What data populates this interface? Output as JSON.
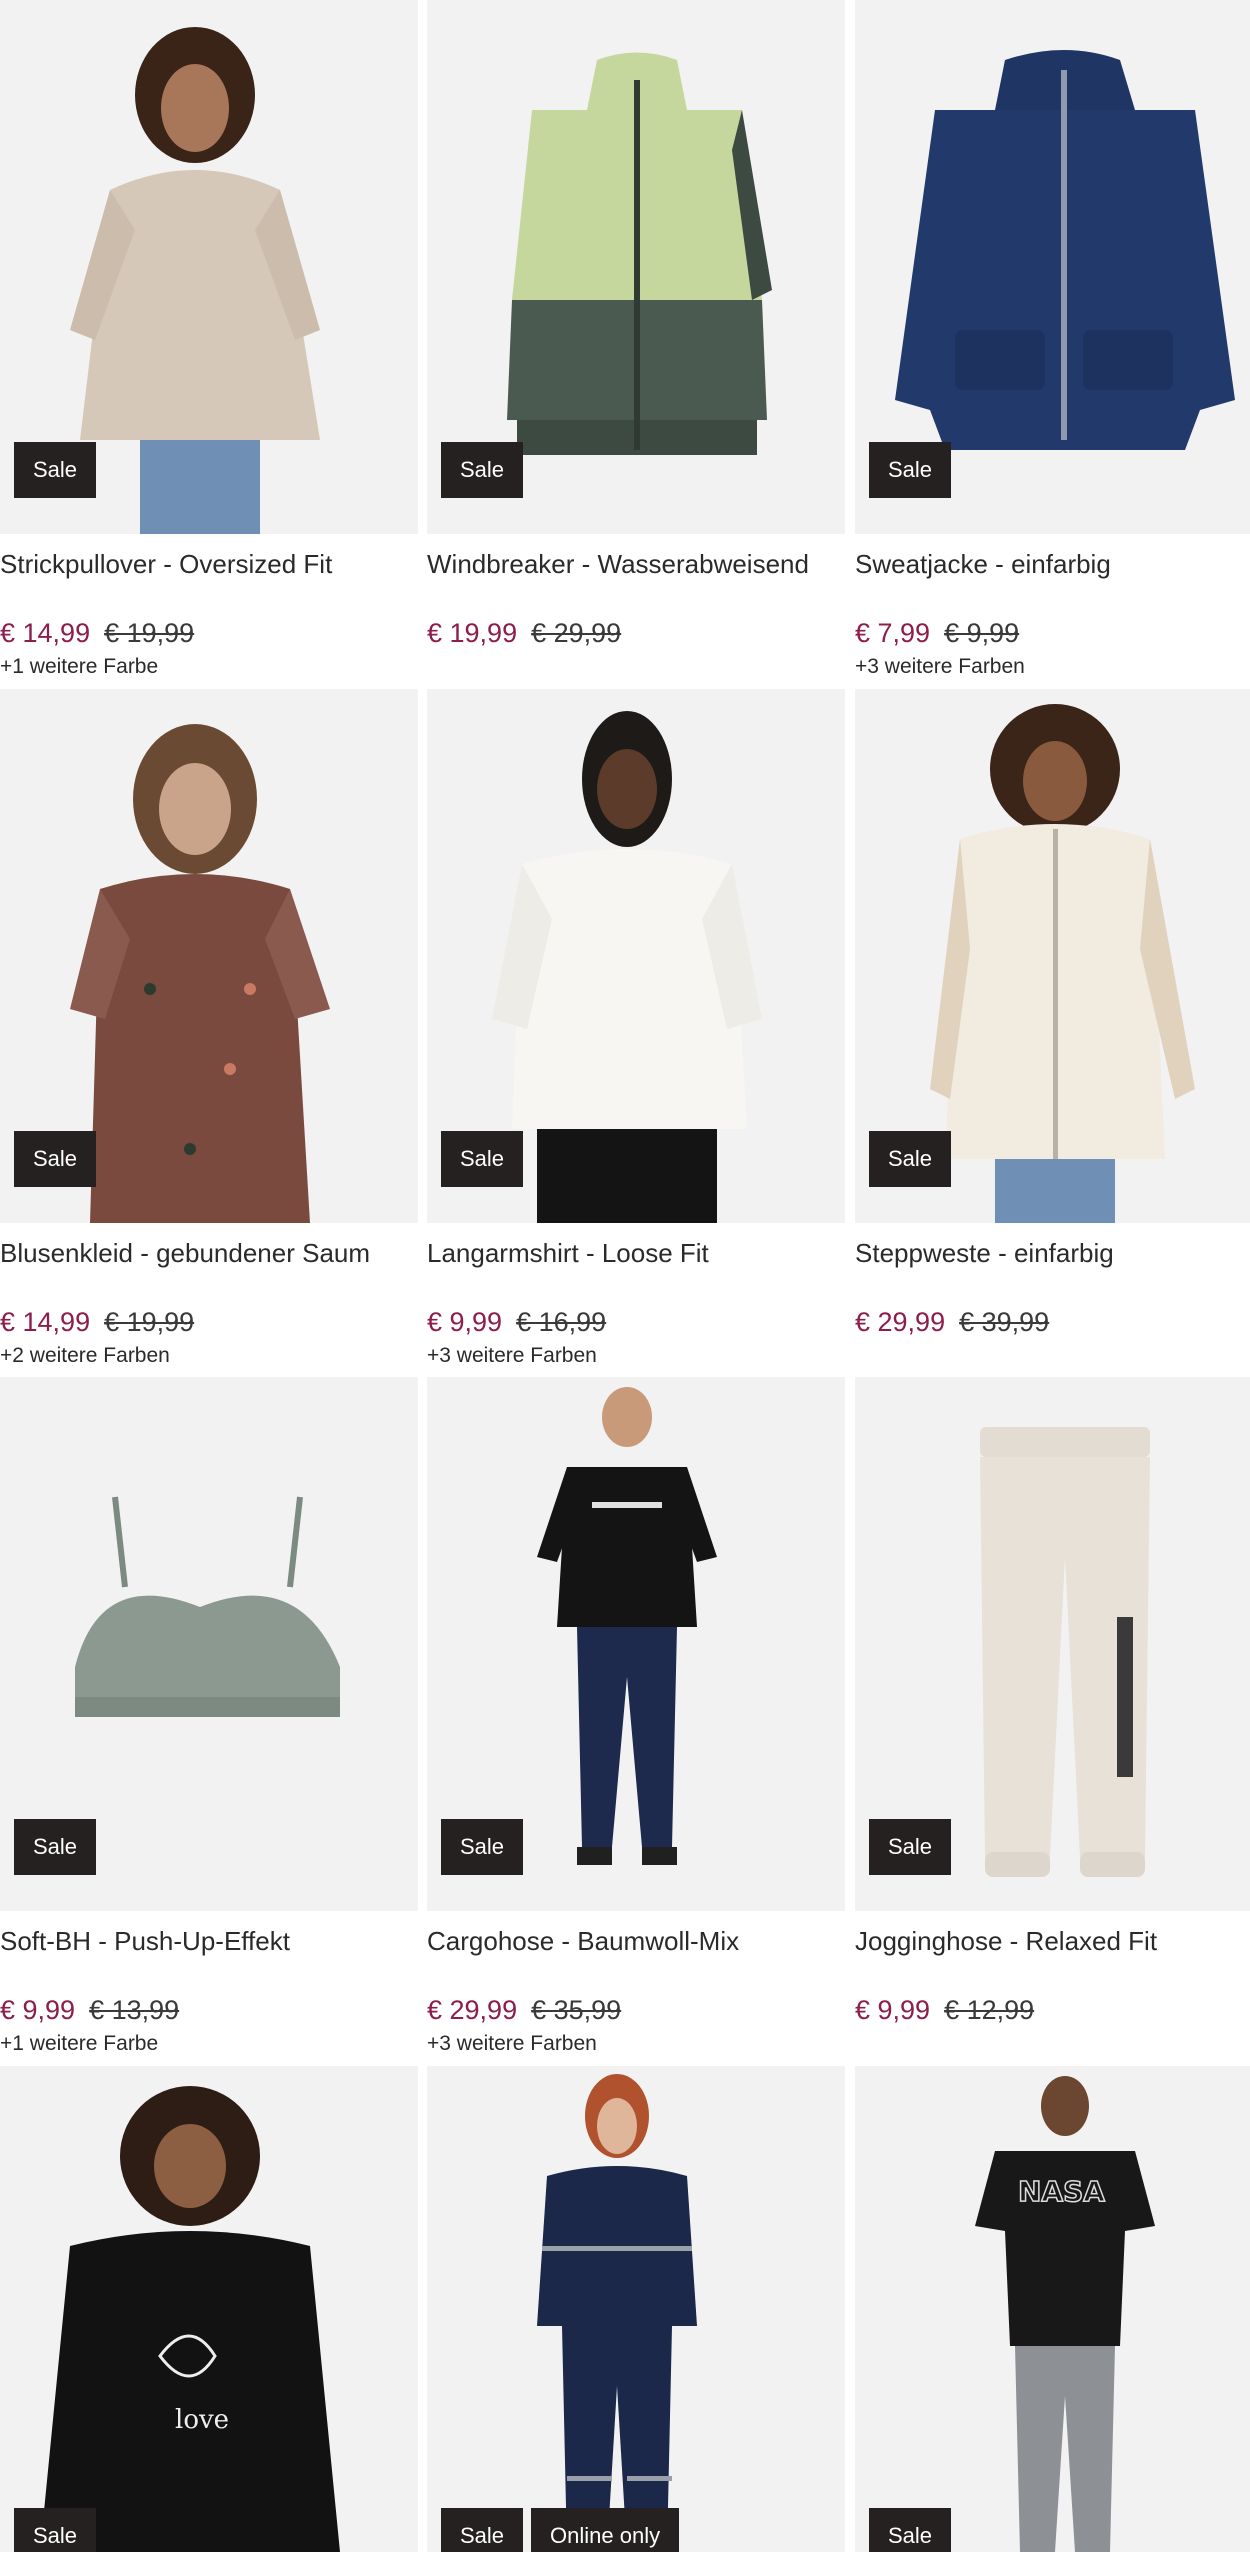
{
  "products": [
    {
      "title": "Strickpullover - Oversized Fit",
      "price": "€ 14,99",
      "old_price": "€ 19,99",
      "more": "+1 weitere Farbe",
      "badges": [
        "Sale"
      ]
    },
    {
      "title": "Windbreaker - Wasserabweisend",
      "price": "€ 19,99",
      "old_price": "€ 29,99",
      "more": "",
      "badges": [
        "Sale"
      ]
    },
    {
      "title": "Sweatjacke - einfarbig",
      "price": "€ 7,99",
      "old_price": "€ 9,99",
      "more": "+3 weitere Farben",
      "badges": [
        "Sale"
      ]
    },
    {
      "title": "Blusenkleid - gebundener Saum",
      "price": "€ 14,99",
      "old_price": "€ 19,99",
      "more": "+2 weitere Farben",
      "badges": [
        "Sale"
      ]
    },
    {
      "title": "Langarmshirt - Loose Fit",
      "price": "€ 9,99",
      "old_price": "€ 16,99",
      "more": "+3 weitere Farben",
      "badges": [
        "Sale"
      ]
    },
    {
      "title": "Steppweste - einfarbig",
      "price": "€ 29,99",
      "old_price": "€ 39,99",
      "more": "",
      "badges": [
        "Sale"
      ]
    },
    {
      "title": "Soft-BH - Push-Up-Effekt",
      "price": "€ 9,99",
      "old_price": "€ 13,99",
      "more": "+1 weitere Farbe",
      "badges": [
        "Sale"
      ]
    },
    {
      "title": "Cargohose - Baumwoll-Mix",
      "price": "€ 29,99",
      "old_price": "€ 35,99",
      "more": "+3 weitere Farben",
      "badges": [
        "Sale"
      ]
    },
    {
      "title": "Jogginghose - Relaxed Fit",
      "price": "€ 9,99",
      "old_price": "€ 12,99",
      "more": "",
      "badges": [
        "Sale"
      ]
    },
    {
      "title": "",
      "price": "",
      "old_price": "",
      "more": "",
      "badges": [
        "Sale"
      ]
    },
    {
      "title": "",
      "price": "",
      "old_price": "",
      "more": "",
      "badges": [
        "Sale",
        "Online only"
      ]
    },
    {
      "title": "",
      "price": "",
      "old_price": "",
      "more": "",
      "badges": [
        "Sale"
      ]
    }
  ],
  "colors": {
    "sale_price": "#8c1d4c",
    "badge_bg": "#262121",
    "image_bg": "#f2f2f2"
  }
}
